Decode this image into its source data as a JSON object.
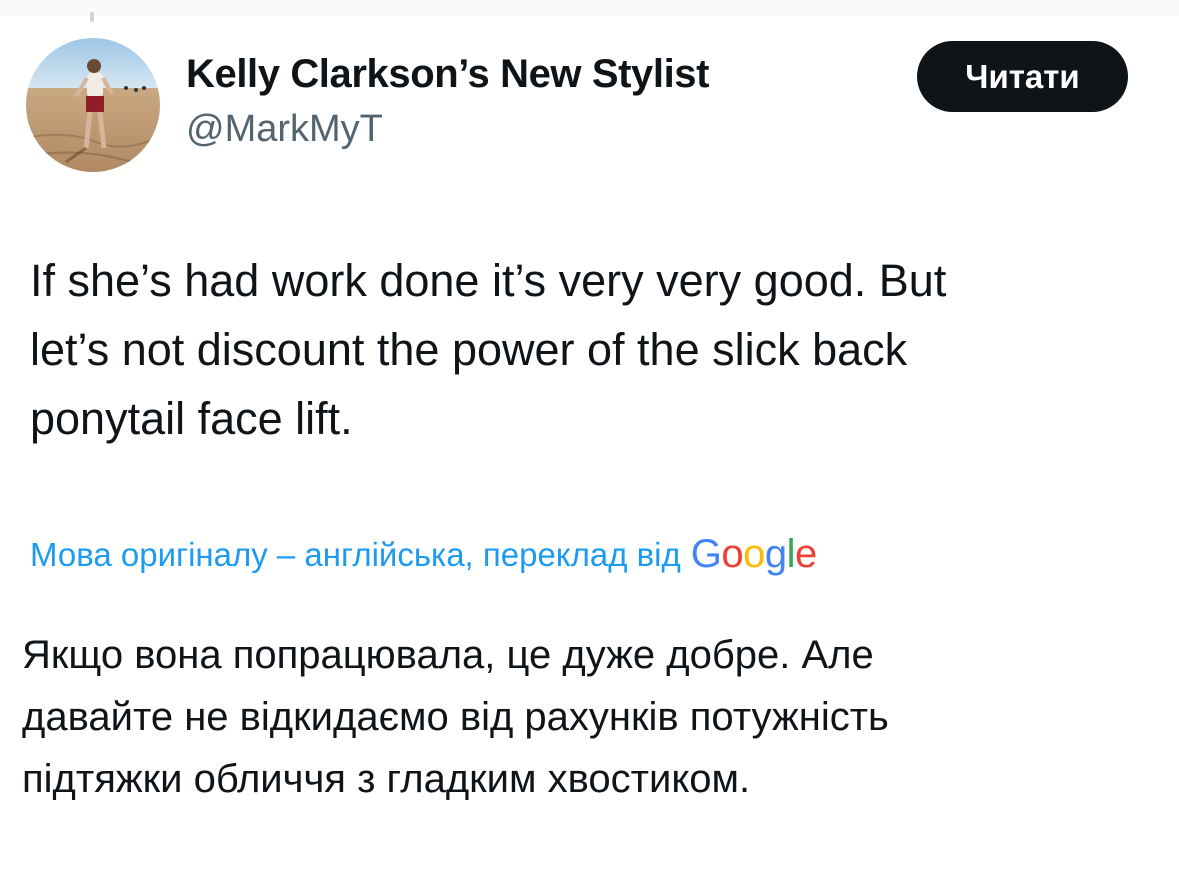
{
  "author": {
    "name": "Kelly Clarkson’s New Stylist",
    "handle": "@MarkMyT"
  },
  "follow_button": {
    "label": "Читати"
  },
  "tweet": {
    "lines": [
      "If she’s had work done it’s very very good. But",
      "let’s not discount the power of the slick back",
      "ponytail face lift."
    ]
  },
  "translation": {
    "note": "Мова оригіналу – англійська, переклад від",
    "provider_logo": "Google",
    "lines": [
      "Якщо вона попрацювала, це дуже добре. Але",
      "давайте не відкидаємо від рахунків потужність",
      "підтяжки обличчя з гладким хвостиком."
    ]
  },
  "colors": {
    "text": "#0f1419",
    "secondary_text": "#536471",
    "link": "#1d9bf0",
    "button_bg": "#0f1419",
    "button_text": "#ffffff"
  }
}
